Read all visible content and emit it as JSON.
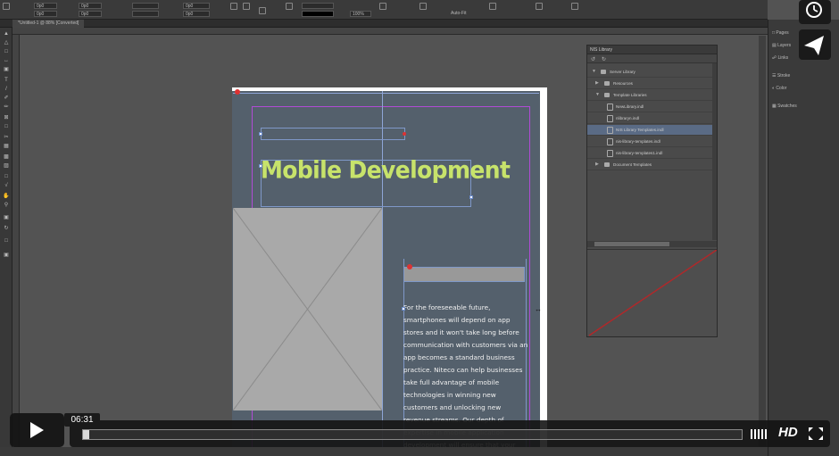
{
  "window": {
    "document_tab": "*Untitled-1 @ 88% [Converted]"
  },
  "control_bar": {
    "fields": [
      "0p0",
      "0p0",
      "0p0",
      "0p0",
      "0p0",
      "0p0"
    ],
    "zoom": "100%",
    "autofit": "Auto-Fit"
  },
  "page": {
    "heading": "Mobile Development",
    "body": "For the foreseeable future, smartphones will depend on app stores and it won't take long before communication with customers via an app becomes a standard business practice.  Niteco can help businesses take full advantage of mobile technologies in winning new customers and unlocking new revenue streams. Our depth of expertise in mobile application development will ensure that your customers reach you wherever they are, whenever they need"
  },
  "library_panel": {
    "title": "NIS Library",
    "items": [
      {
        "label": "Server Library",
        "type": "folder"
      },
      {
        "label": "Resources",
        "type": "folder"
      },
      {
        "label": "Template Libraries",
        "type": "folder"
      },
      {
        "label": "NewLibrary.indl",
        "type": "file"
      },
      {
        "label": "nlibraryn.indl",
        "type": "file"
      },
      {
        "label": "NIS Library Templates.indl",
        "type": "file",
        "selected": true
      },
      {
        "label": "nis-library-templates.indl",
        "type": "file"
      },
      {
        "label": "nis-library-templates1.indl",
        "type": "file"
      },
      {
        "label": "Document Templates",
        "type": "folder"
      }
    ]
  },
  "right_dock": {
    "items": [
      "Pages",
      "Layers",
      "Links",
      "Stroke",
      "Color",
      "Swatches"
    ]
  },
  "player": {
    "time": "06:31",
    "hd": "HD",
    "progress": 0.01
  },
  "colors": {
    "heading": "#c7e36b",
    "frame_border": "#7f98c8",
    "guide_magenta": "#b04bd6",
    "selected_row": "#5a6b85",
    "preview_line": "#b0282a"
  }
}
